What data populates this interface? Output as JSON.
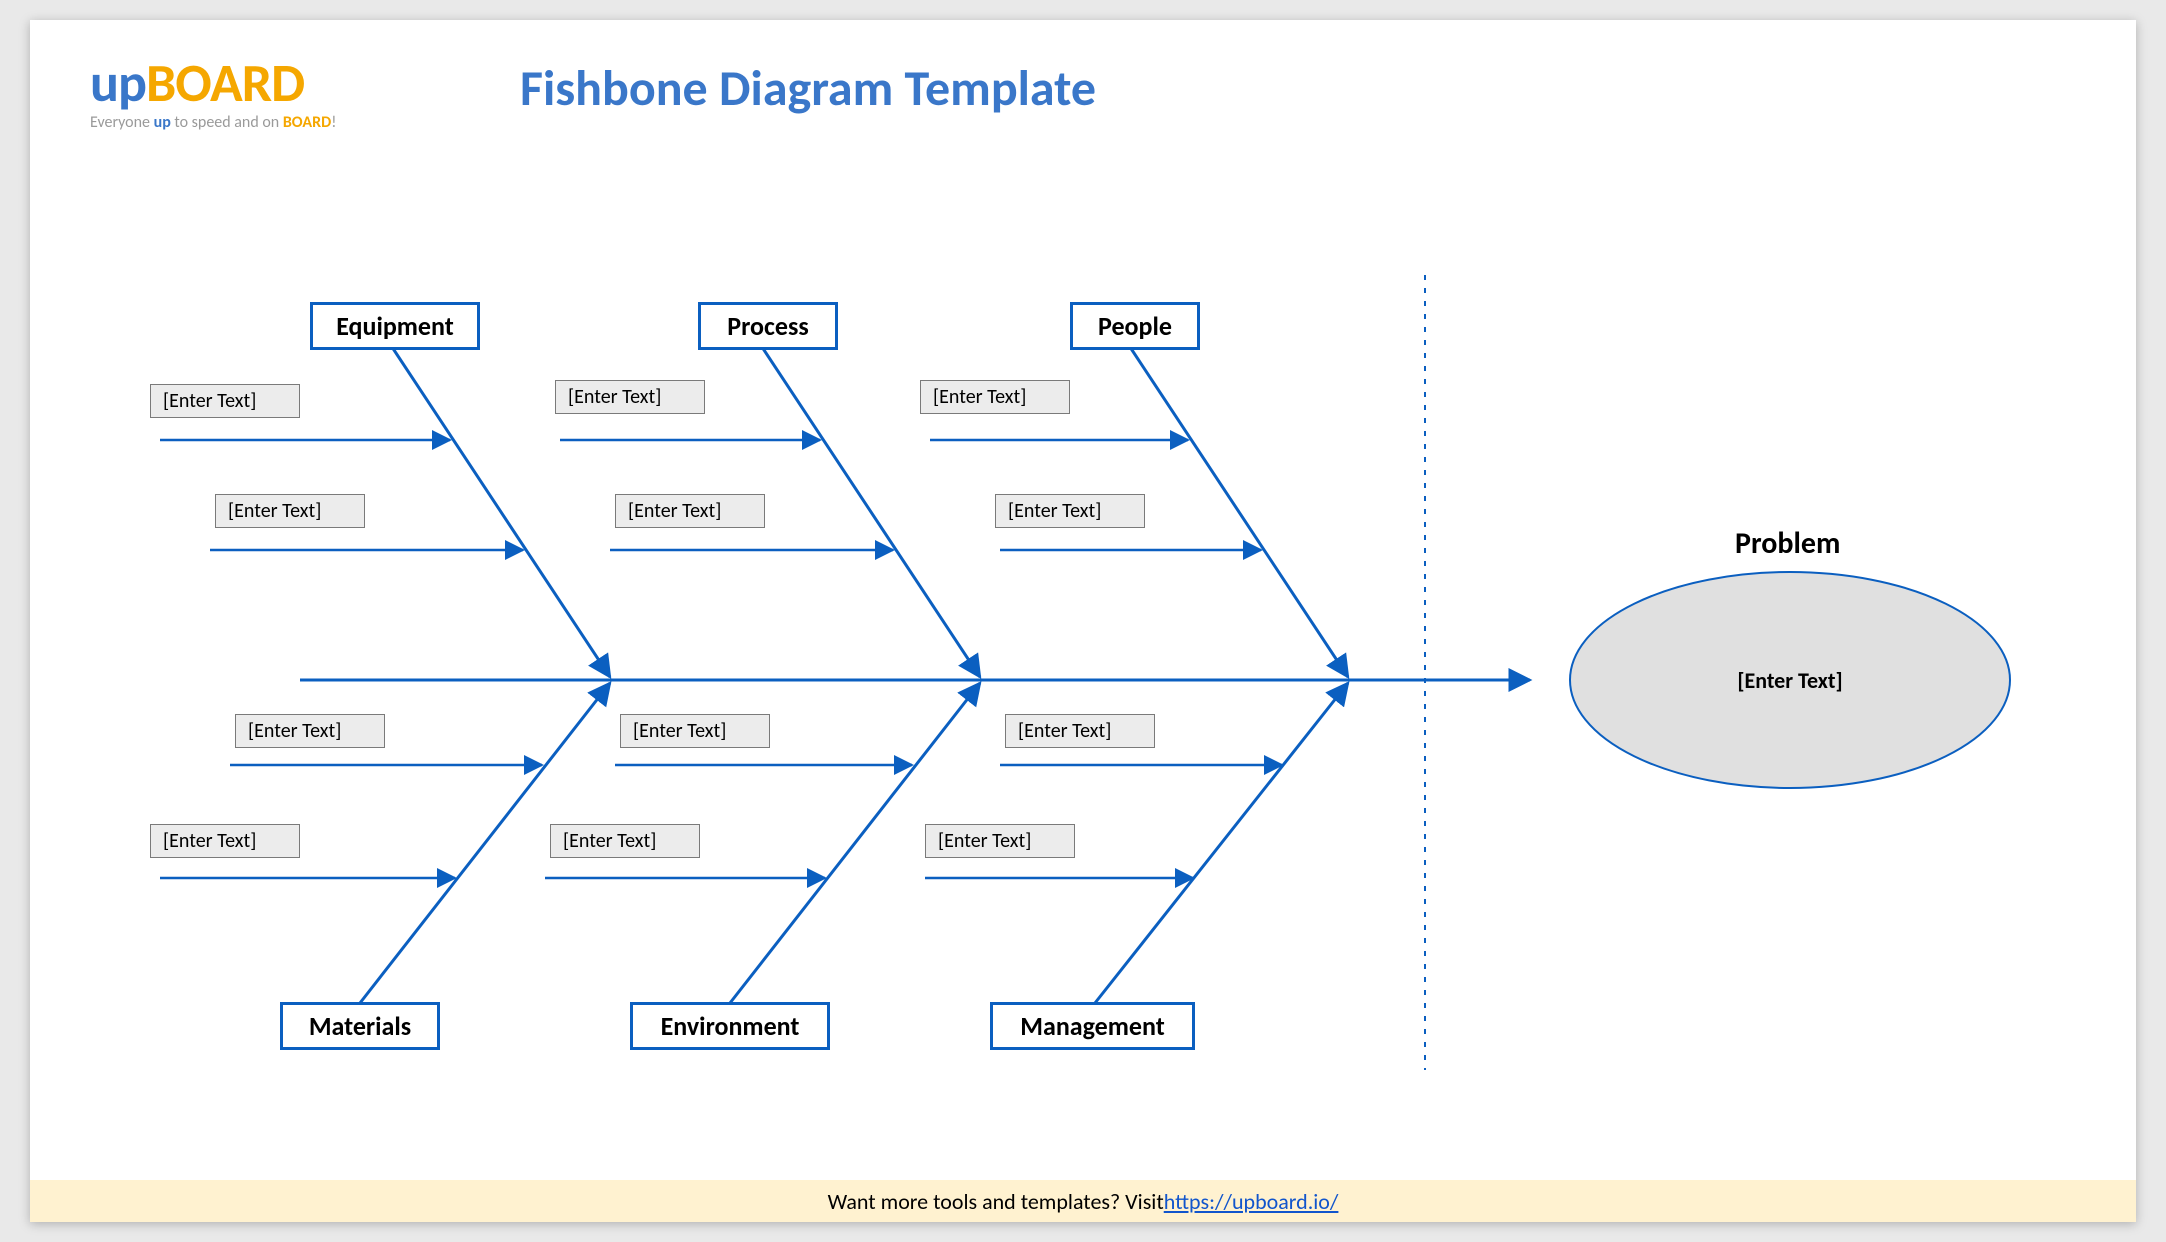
{
  "brand": {
    "logo_up": "up",
    "logo_board": "BOARD",
    "tagline_pre": "Everyone ",
    "tagline_up": "up",
    "tagline_mid": " to speed and on ",
    "tagline_board": "BOARD",
    "tagline_post": "!"
  },
  "title": "Fishbone Diagram Template",
  "problem": {
    "label": "Problem",
    "placeholder": "[Enter Text]"
  },
  "categories": {
    "top": [
      "Equipment",
      "Process",
      "People"
    ],
    "bottom": [
      "Materials",
      "Environment",
      "Management"
    ]
  },
  "cause_placeholder": "[Enter Text]",
  "footer": {
    "text": "Want more tools and templates? Visit ",
    "link_text": "https://upboard.io/"
  },
  "colors": {
    "accent": "#0b5fc0",
    "orange": "#f5a700",
    "footer_bg": "#fff2d0",
    "ellipse_fill": "#e0e0e0"
  }
}
